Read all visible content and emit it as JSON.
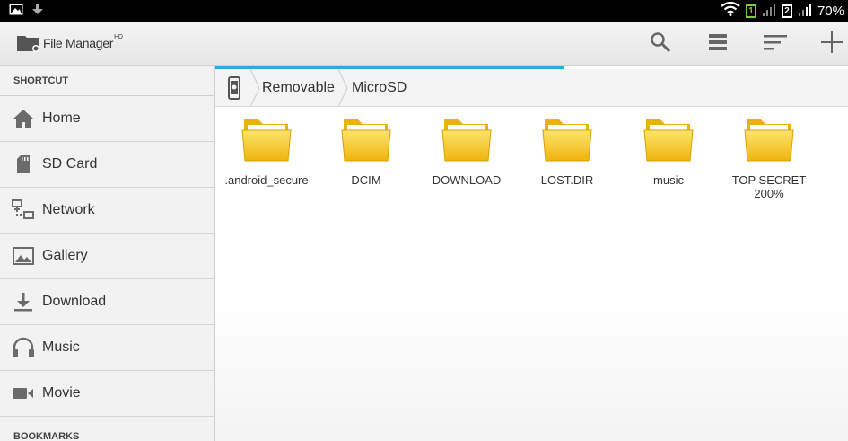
{
  "status_bar": {
    "battery": "70%",
    "sim1_label": "1",
    "sim2_label": "2",
    "icons": [
      "picture-icon",
      "download-icon",
      "wifi-icon",
      "signal-icon",
      "signal-icon"
    ]
  },
  "action_bar": {
    "title": "File Manager",
    "title_sup": "HD",
    "actions": [
      "search-icon",
      "view-list-icon",
      "sort-icon",
      "add-icon"
    ]
  },
  "sidebar": {
    "shortcut_header": "SHORTCUT",
    "items": [
      {
        "label": "Home",
        "icon": "home-icon"
      },
      {
        "label": "SD Card",
        "icon": "sd-card-icon"
      },
      {
        "label": "Network",
        "icon": "network-icon"
      },
      {
        "label": "Gallery",
        "icon": "gallery-icon"
      },
      {
        "label": "Download",
        "icon": "download-icon"
      },
      {
        "label": "Music",
        "icon": "headphones-icon"
      },
      {
        "label": "Movie",
        "icon": "video-camera-icon"
      }
    ],
    "bookmarks_header": "BOOKMARKS"
  },
  "main": {
    "loading_progress": 0.55,
    "breadcrumb": [
      "Removable",
      "MicroSD"
    ],
    "folders": [
      {
        "name": ".android_secure"
      },
      {
        "name": "DCIM"
      },
      {
        "name": "DOWNLOAD"
      },
      {
        "name": "LOST.DIR"
      },
      {
        "name": "music"
      },
      {
        "name": "TOP SECRET\n200%"
      }
    ]
  },
  "colors": {
    "accent": "#2aa9e0",
    "folder_yellow": "#f7c81e"
  }
}
